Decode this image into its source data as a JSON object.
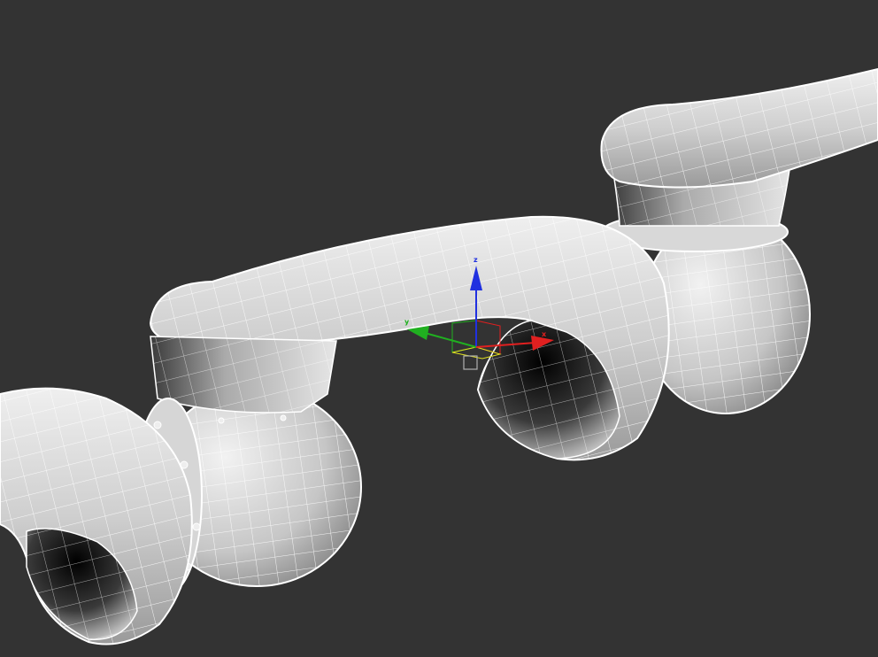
{
  "viewport": {
    "background_color": "#333333",
    "mesh_fill_color": "#c8c8c8",
    "wire_color": "#ffffff",
    "description_free": true
  },
  "gizmo": {
    "axes": [
      {
        "id": "x",
        "letter": "x",
        "color": "#e02020"
      },
      {
        "id": "y",
        "letter": "y",
        "color": "#20b020"
      },
      {
        "id": "z",
        "letter": "z",
        "color": "#2030e0"
      }
    ],
    "plane_yellow": "#e0e020",
    "center_box_color": "#b0b0b0",
    "center_box_icon": "pivot-box-icon"
  }
}
